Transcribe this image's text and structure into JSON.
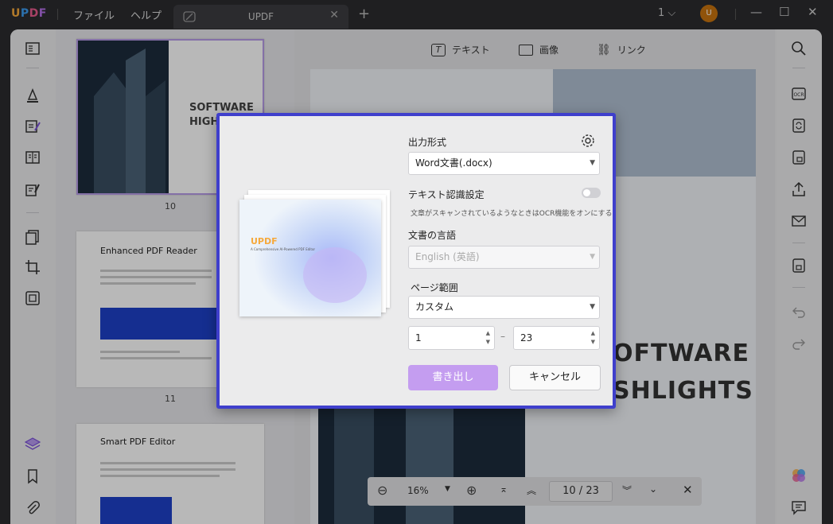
{
  "app": {
    "logo": "UPDF",
    "menu": [
      "ファイル",
      "ヘルプ"
    ],
    "tab_title": "UPDF",
    "page_count": "1",
    "avatar_initial": "U"
  },
  "edit_toolbar": {
    "text": "テキスト",
    "image": "画像",
    "link": "リンク"
  },
  "thumbnails": [
    {
      "number": "10",
      "title": "SOFTWARE HIGHLIGHTS"
    },
    {
      "number": "11",
      "title": "Enhanced PDF Reader"
    },
    {
      "number": "",
      "title": "Smart PDF Editor"
    }
  ],
  "page_content": {
    "heading_line1": "OFTWARE",
    "heading_line2": "SHLIGHTS"
  },
  "zoom": {
    "level": "16%",
    "current_page": "10",
    "separator": "/",
    "total_pages": "23"
  },
  "dialog": {
    "preview_logo": "UPDF",
    "preview_subtitle": "A Comprehensive AI-Powered PDF Editor",
    "output_format_label": "出力形式",
    "output_format_value": "Word文書(.docx)",
    "ocr_label": "テキスト認識設定",
    "ocr_enabled": false,
    "ocr_hint": "文章がスキャンされているようなときはOCR機能をオンにする",
    "language_label": "文書の言語",
    "language_value": "English (英語)",
    "page_range_label": "ページ範囲",
    "page_range_value": "カスタム",
    "range_from": "1",
    "range_dash": "–",
    "range_to": "23",
    "export_button": "書き出し",
    "cancel_button": "キャンセル"
  },
  "colors": {
    "accent": "#3f3fcc",
    "primary_button": "#c49df0",
    "avatar": "#c8740f"
  }
}
